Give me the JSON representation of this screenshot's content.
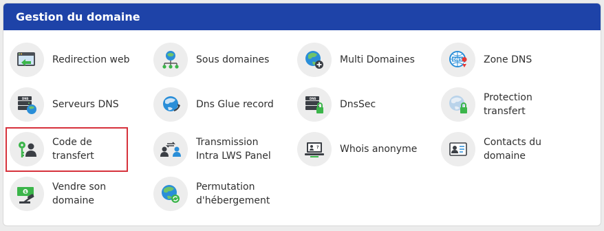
{
  "panel": {
    "title": "Gestion du domaine"
  },
  "items": [
    {
      "label": "Redirection web",
      "icon": "browser-redirect-icon"
    },
    {
      "label": "Sous domaines",
      "icon": "globe-network-icon"
    },
    {
      "label": "Multi Domaines",
      "icon": "globe-plus-icon"
    },
    {
      "label": "Zone DNS",
      "icon": "dns-globe-pin-icon"
    },
    {
      "label": "Serveurs DNS",
      "icon": "dns-server-globe-icon"
    },
    {
      "label": "Dns Glue record",
      "icon": "globe-glue-icon"
    },
    {
      "label": "DnsSec",
      "icon": "dns-server-lock-icon"
    },
    {
      "label": "Protection\ntransfert",
      "icon": "globe-lock-icon"
    },
    {
      "label": "Code de\ntransfert",
      "icon": "key-user-icon"
    },
    {
      "label": "Transmission\nIntra LWS Panel",
      "icon": "users-transfer-icon"
    },
    {
      "label": "Whois anonyme",
      "icon": "anonymous-laptop-icon"
    },
    {
      "label": "Contacts du\ndomaine",
      "icon": "contact-card-icon"
    },
    {
      "label": "Vendre son\ndomaine",
      "icon": "money-gavel-icon"
    },
    {
      "label": "Permutation\nd'hébergement",
      "icon": "globe-sync-icon"
    }
  ],
  "colors": {
    "header": "#1e43a8",
    "highlight": "#d6313b"
  }
}
